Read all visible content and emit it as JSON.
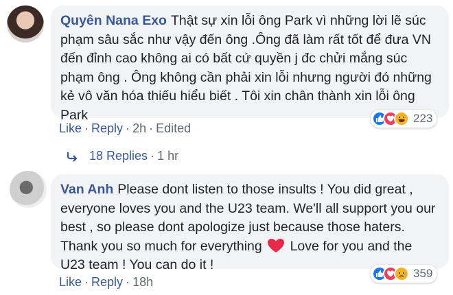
{
  "comments": [
    {
      "author": "Quyên Nana Exo",
      "text": "Thật sự xin lỗi ông Park vì những lời lẽ súc phạm sâu sắc như vậy đến ông .Ông đã làm rất tốt để đưa VN đến đỉnh cao không ai có bất cứ quyền j đc chửi mắng súc phạm ông . Ông không cần phải xin lỗi nhưng người đó những kẻ vô văn hóa thiếu hiểu biết . Tôi xin chân thành xin lỗi ông Park",
      "reactions": {
        "icons": [
          "like-icon",
          "love-icon",
          "haha-icon"
        ],
        "count": "223"
      },
      "actions": {
        "like": "Like",
        "reply": "Reply",
        "time": "2h",
        "edited": "Edited"
      },
      "replies": {
        "label": "18 Replies",
        "time": "1 hr"
      }
    },
    {
      "author": "Van Anh",
      "text_before_emoji": "Please dont listen to those insults ! You did great , everyone loves you and the U23 team. We'll all support you our best , so please dont apologize just because those haters. Thank you so much for everything",
      "emoji": "heart-emoji",
      "text_after_emoji": "Love for you and the U23 team ! You can do it !",
      "reactions": {
        "icons": [
          "like-icon",
          "love-icon",
          "sad-icon"
        ],
        "count": "359"
      },
      "actions": {
        "like": "Like",
        "reply": "Reply",
        "time": "18h"
      }
    }
  ],
  "colors": {
    "link": "#385898",
    "meta": "#606770",
    "bubble": "#f2f3f5",
    "like": "#1877f2",
    "love": "#f33e58",
    "emoji": "#f7b125"
  }
}
